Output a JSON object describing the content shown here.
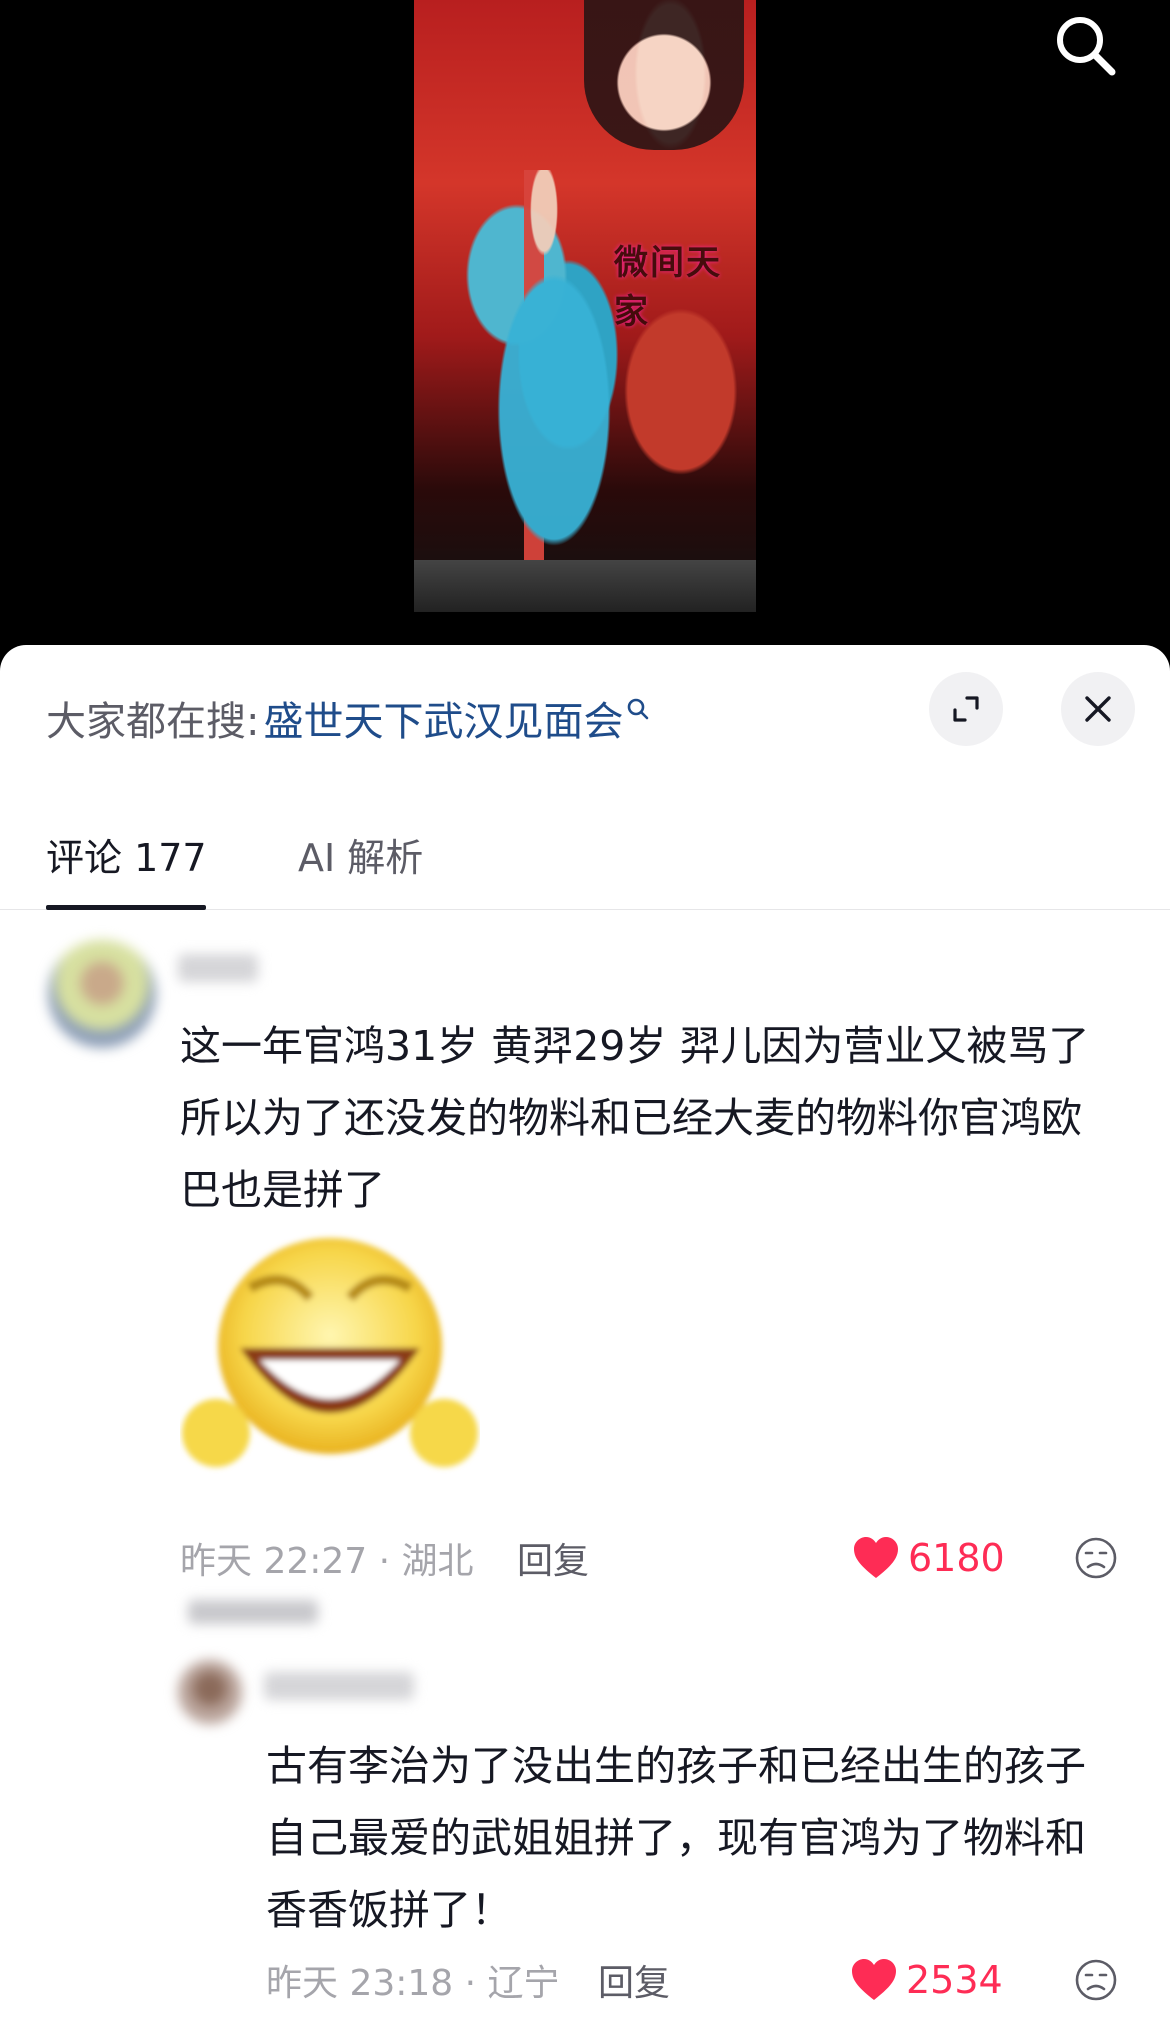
{
  "header": {
    "hot_search_prefix": "大家都在搜:",
    "hot_search_term": "盛世天下武汉见面会"
  },
  "video": {
    "title_overlay": "微间天家"
  },
  "tabs": [
    {
      "label": "评论 177",
      "active": true
    },
    {
      "label": "AI 解析",
      "active": false
    }
  ],
  "comments": [
    {
      "text": "这一年官鸿31岁 黄羿29岁 羿儿因为营业又被骂了 所以为了还没发的物料和已经大麦的物料你官鸿欧巴也是拼了",
      "time_location": "昨天 22:27 · 湖北",
      "reply_label": "回复",
      "likes": "6180",
      "has_sticker": true
    },
    {
      "text": "古有李治为了没出生的孩子和已经出生的孩子自己最爱的武姐姐拼了，现有官鸿为了物料和香香饭拼了！",
      "time_location": "昨天 23:18 · 辽宁",
      "reply_label": "回复",
      "likes": "2534"
    }
  ],
  "colors": {
    "like": "#fe2c55",
    "link": "#1f4c8a",
    "text": "#161823",
    "muted": "#a5a5ab"
  },
  "icons": [
    "search-icon",
    "expand-icon",
    "close-icon",
    "heart-icon",
    "dislike-icon",
    "search-mini-icon"
  ]
}
